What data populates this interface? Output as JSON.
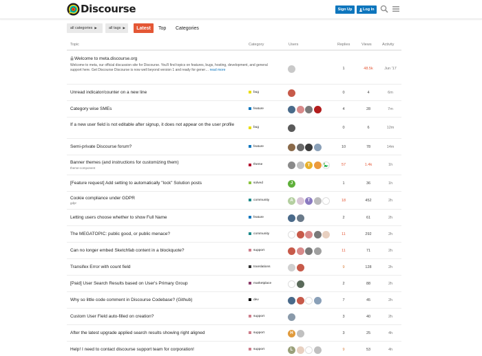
{
  "header": {
    "brand": "Discourse",
    "signup_label": "Sign Up",
    "login_label": "Log In",
    "colors": {
      "primary": "#0e76bd",
      "accent": "#e45735"
    }
  },
  "nav": {
    "categories_filter": "all categories",
    "tags_filter": "all tags",
    "tabs": [
      {
        "label": "Latest",
        "active": true
      },
      {
        "label": "Top"
      },
      {
        "label": "Categories"
      }
    ]
  },
  "columns": {
    "topic": "Topic",
    "category": "Category",
    "users": "Users",
    "replies": "Replies",
    "views": "Views",
    "activity": "Activity"
  },
  "topics": [
    {
      "title": "Welcome to meta.discourse.org",
      "pinned": true,
      "excerpt": "Welcome to meta, our official discussion site for Discourse. You'll find topics on features, bugs, hosting, development, and general support here. Get Discourse Discourse is now well beyond version 1 and ready for gener…",
      "read_more": "read more",
      "category": "",
      "cat_color": "",
      "users": [
        {
          "c": "#c9c9c9",
          "t": ""
        }
      ],
      "replies": "1",
      "views": "48.5k",
      "views_hot": true,
      "activity": "Jun '17"
    },
    {
      "title": "Unread indicator/counter on a new line",
      "category": "bug",
      "cat_color": "#e9dd00",
      "users": [
        {
          "c": "#c75a4a",
          "t": ""
        }
      ],
      "replies": "0",
      "views": "4",
      "activity": "6m"
    },
    {
      "title": "Category wise SMEs",
      "category": "feature",
      "cat_color": "#0e76bd",
      "users": [
        {
          "c": "#4a6b8a",
          "t": ""
        },
        {
          "c": "#d88a8a",
          "t": ""
        },
        {
          "c": "#7a7a7a",
          "t": ""
        },
        {
          "c": "#b21d1d",
          "t": ""
        }
      ],
      "replies": "4",
      "views": "28",
      "activity": "7m"
    },
    {
      "title": "If a new user field is not editable after signup, it does not appear on the user profile",
      "category": "bug",
      "cat_color": "#e9dd00",
      "users": [
        {
          "c": "#5a5a5a",
          "t": ""
        }
      ],
      "replies": "0",
      "views": "6",
      "activity": "12m"
    },
    {
      "title": "Semi-private Discourse forum?",
      "category": "feature",
      "cat_color": "#0e76bd",
      "users": [
        {
          "c": "#8a6a4a",
          "t": ""
        },
        {
          "c": "#6a6a6a",
          "t": ""
        },
        {
          "c": "#3a3a3a",
          "t": ""
        },
        {
          "c": "#8aa0b8",
          "t": ""
        }
      ],
      "replies": "10",
      "views": "78",
      "activity": "14m"
    },
    {
      "title": "Banner themes (and instructions for customizing them)",
      "subtag": "theme-component",
      "category": "theme",
      "cat_color": "#b3002d",
      "users": [
        {
          "c": "#8a8a8a",
          "t": ""
        },
        {
          "c": "#c0c0c0",
          "t": ""
        },
        {
          "c": "#e8b02a",
          "t": "T"
        },
        {
          "c": "#ec9a3c",
          "t": ""
        },
        {
          "c": "#fff",
          "t": "🦕"
        }
      ],
      "replies": "57",
      "replies_hot": true,
      "views": "1.4k",
      "views_hot": true,
      "activity": "1h"
    },
    {
      "title": "[Feature request] Add setting to automatically \"lock\" Solution posts",
      "category": "solved",
      "cat_color": "#8cc43f",
      "users": [
        {
          "c": "#5fb03b",
          "t": "J"
        }
      ],
      "replies": "1",
      "views": "36",
      "activity": "1h"
    },
    {
      "title": "Cookie compliance under GDPR",
      "subtag": "gdpr",
      "category": "community",
      "cat_color": "#1d8a8a",
      "users": [
        {
          "c": "#b4cfa0",
          "t": "A"
        },
        {
          "c": "#d8c4d8",
          "t": ""
        },
        {
          "c": "#8a7ac0",
          "t": "T"
        },
        {
          "c": "#bcbcbc",
          "t": ""
        },
        {
          "c": "#fff",
          "t": ""
        }
      ],
      "replies": "18",
      "replies_hot": true,
      "views": "452",
      "activity": "2h"
    },
    {
      "title": "Letting users choose whether to show Full Name",
      "category": "feature",
      "cat_color": "#0e76bd",
      "users": [
        {
          "c": "#4a6a8a",
          "t": ""
        },
        {
          "c": "#6a7a8a",
          "t": ""
        }
      ],
      "replies": "2",
      "views": "61",
      "activity": "2h"
    },
    {
      "title": "The MEGATOPIC: public good, or public menace?",
      "category": "community",
      "cat_color": "#1d8a8a",
      "users": [
        {
          "c": "#fff",
          "t": ""
        },
        {
          "c": "#c75a4a",
          "t": ""
        },
        {
          "c": "#d88a8a",
          "t": ""
        },
        {
          "c": "#7a7a7a",
          "t": ""
        },
        {
          "c": "#e8d0c0",
          "t": ""
        }
      ],
      "replies": "11",
      "replies_hot": true,
      "views": "292",
      "activity": "2h"
    },
    {
      "title": "Can no longer embed Sketchfab content in a blockquote?",
      "category": "support",
      "cat_color": "#ce7e8c",
      "users": [
        {
          "c": "#c75a4a",
          "t": ""
        },
        {
          "c": "#d88a8a",
          "t": ""
        },
        {
          "c": "#7a7a7a",
          "t": ""
        },
        {
          "c": "#a0a0a0",
          "t": ""
        }
      ],
      "replies": "11",
      "replies_hot": true,
      "views": "71",
      "activity": "2h"
    },
    {
      "title": "Transifex Error with count field",
      "category": "translations",
      "cat_color": "#333333",
      "users": [
        {
          "c": "#d0d0d0",
          "t": ""
        },
        {
          "c": "#c75a4a",
          "t": ""
        }
      ],
      "replies": "9",
      "replies_warm": true,
      "views": "128",
      "activity": "2h"
    },
    {
      "title": "[Paid] User Search Results based on User's Primary Group",
      "category": "marketplace",
      "cat_color": "#8c3d6b",
      "users": [
        {
          "c": "#fff",
          "t": ""
        },
        {
          "c": "#5a6a5a",
          "t": ""
        }
      ],
      "replies": "2",
      "views": "88",
      "activity": "2h"
    },
    {
      "title": "Why so little code comment in Discourse Codebase? (Github)",
      "category": "dev",
      "cat_color": "#000000",
      "users": [
        {
          "c": "#4a6a8a",
          "t": ""
        },
        {
          "c": "#c75a4a",
          "t": ""
        },
        {
          "c": "#fff",
          "t": ""
        },
        {
          "c": "#8aa0b8",
          "t": ""
        }
      ],
      "replies": "7",
      "views": "45",
      "activity": "2h"
    },
    {
      "title": "Custom User Field auto-filled on creation?",
      "category": "support",
      "cat_color": "#ce7e8c",
      "users": [
        {
          "c": "#8a9aaa",
          "t": ""
        }
      ],
      "replies": "3",
      "views": "40",
      "activity": "2h"
    },
    {
      "title": "After the latest upgrade applied search results showing right aligned",
      "category": "support",
      "cat_color": "#ce7e8c",
      "users": [
        {
          "c": "#e09a3c",
          "t": "H"
        },
        {
          "c": "#c0c0c0",
          "t": ""
        }
      ],
      "replies": "3",
      "views": "25",
      "activity": "4h"
    },
    {
      "title": "Help! I need to contact discourse support team for corporation!",
      "category": "support",
      "cat_color": "#ce7e8c",
      "users": [
        {
          "c": "#9aa07a",
          "t": "L"
        },
        {
          "c": "#e8d0c0",
          "t": ""
        },
        {
          "c": "#fff",
          "t": ""
        },
        {
          "c": "#c0c0c0",
          "t": ""
        }
      ],
      "replies": "9",
      "replies_warm": true,
      "views": "53",
      "activity": "4h"
    }
  ]
}
